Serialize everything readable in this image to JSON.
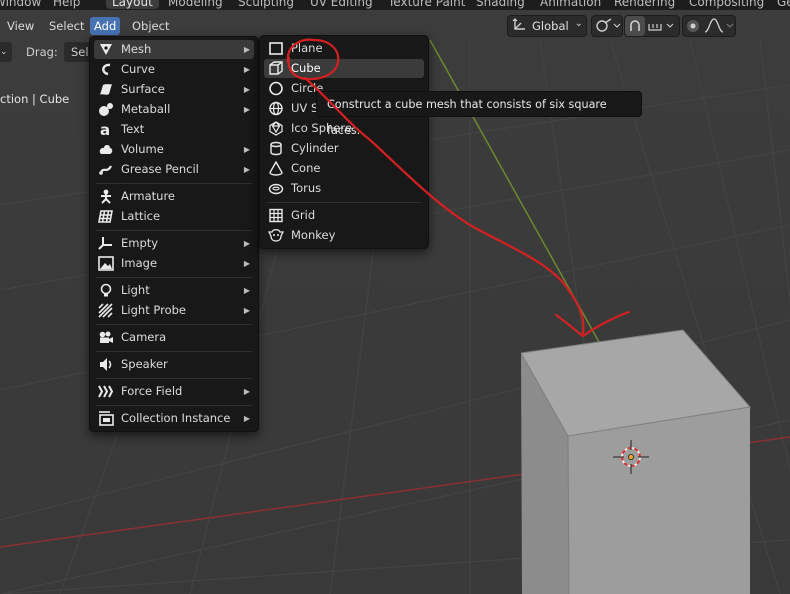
{
  "topbar": {
    "tabs": [
      "Window",
      "Help",
      "Layout",
      "Modeling",
      "Sculpting",
      "UV Editing",
      "Texture Paint",
      "Shading",
      "Animation",
      "Rendering",
      "Compositing",
      "Ge"
    ]
  },
  "header": {
    "menus": [
      "View",
      "Select",
      "Add",
      "Object"
    ],
    "orientation": "Global",
    "drag_label": "Drag:",
    "drag_value": "Sel"
  },
  "viewport": {
    "collection_text": "ction | Cube"
  },
  "add_menu": {
    "items": [
      {
        "label": "Mesh",
        "icon": "mesh-icon",
        "submenu": true,
        "highlight": true
      },
      {
        "label": "Curve",
        "icon": "curve-icon",
        "submenu": true
      },
      {
        "label": "Surface",
        "icon": "surface-icon",
        "submenu": true
      },
      {
        "label": "Metaball",
        "icon": "metaball-icon",
        "submenu": true
      },
      {
        "label": "Text",
        "icon": "text-icon",
        "submenu": false
      },
      {
        "label": "Volume",
        "icon": "volume-icon",
        "submenu": true
      },
      {
        "label": "Grease Pencil",
        "icon": "grease-pencil-icon",
        "submenu": true
      },
      {
        "label": "Armature",
        "icon": "armature-icon",
        "submenu": false
      },
      {
        "label": "Lattice",
        "icon": "lattice-icon",
        "submenu": false
      },
      {
        "label": "Empty",
        "icon": "empty-icon",
        "submenu": true
      },
      {
        "label": "Image",
        "icon": "image-icon",
        "submenu": true
      },
      {
        "label": "Light",
        "icon": "light-icon",
        "submenu": true
      },
      {
        "label": "Light Probe",
        "icon": "light-probe-icon",
        "submenu": true
      },
      {
        "label": "Camera",
        "icon": "camera-icon",
        "submenu": false
      },
      {
        "label": "Speaker",
        "icon": "speaker-icon",
        "submenu": false
      },
      {
        "label": "Force Field",
        "icon": "force-field-icon",
        "submenu": true
      },
      {
        "label": "Collection Instance",
        "icon": "collection-icon",
        "submenu": true
      }
    ]
  },
  "mesh_menu": {
    "items": [
      {
        "label": "Plane",
        "icon": "plane-icon"
      },
      {
        "label": "Cube",
        "icon": "cube-icon",
        "selected": true
      },
      {
        "label": "Circle",
        "icon": "circle-icon"
      },
      {
        "label": "UV Sphere",
        "icon": "uv-sphere-icon"
      },
      {
        "label": "Ico Sphere",
        "icon": "ico-sphere-icon"
      },
      {
        "label": "Cylinder",
        "icon": "cylinder-icon"
      },
      {
        "label": "Cone",
        "icon": "cone-icon"
      },
      {
        "label": "Torus",
        "icon": "torus-icon"
      },
      {
        "label": "Grid",
        "icon": "grid-icon"
      },
      {
        "label": "Monkey",
        "icon": "monkey-icon"
      }
    ]
  },
  "tooltip": {
    "text": "Construct a cube mesh that consists of six square faces."
  },
  "colors": {
    "menu_bg": "#181818",
    "accent": "#4772b3",
    "viewport_bg": "#3a3a3a",
    "annotation": "#d42020",
    "x_axis": "#8a2f35",
    "y_axis": "#6d8a2b"
  }
}
